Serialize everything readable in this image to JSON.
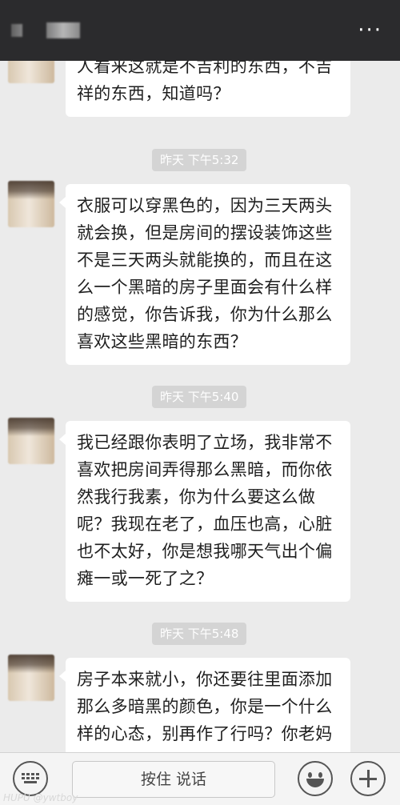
{
  "header": {
    "more_label": "···"
  },
  "messages": [
    {
      "text": "人看来这就是不吉利的东西，不吉祥的东西，知道吗？"
    },
    {
      "time": "昨天 下午5:32",
      "text": "衣服可以穿黑色的，因为三天两头就会换，但是房间的摆设装饰这些不是三天两头就能换的，而且在这么一个黑暗的房子里面会有什么样的感觉，你告诉我，你为什么那么喜欢这些黑暗的东西？"
    },
    {
      "time": "昨天 下午5:40",
      "text": "我已经跟你表明了立场，我非常不喜欢把房间弄得那么黑暗，而你依然我行我素，你为什么要这么做呢？我现在老了，血压也高，心脏也不太好，你是想我哪天气出个偏瘫一或一死了之？"
    },
    {
      "time": "昨天 下午5:48",
      "text": "房子本来就小，你还要往里面添加那么多暗黑的颜色，你是一个什么样的心态，别再作了行吗？你老妈"
    }
  ],
  "input": {
    "hold_to_talk": "按住 说话"
  },
  "watermark": "HUPU @ywtboy",
  "icons": [
    "keyboard-icon",
    "emoji-icon",
    "plus-icon",
    "more-icon"
  ]
}
